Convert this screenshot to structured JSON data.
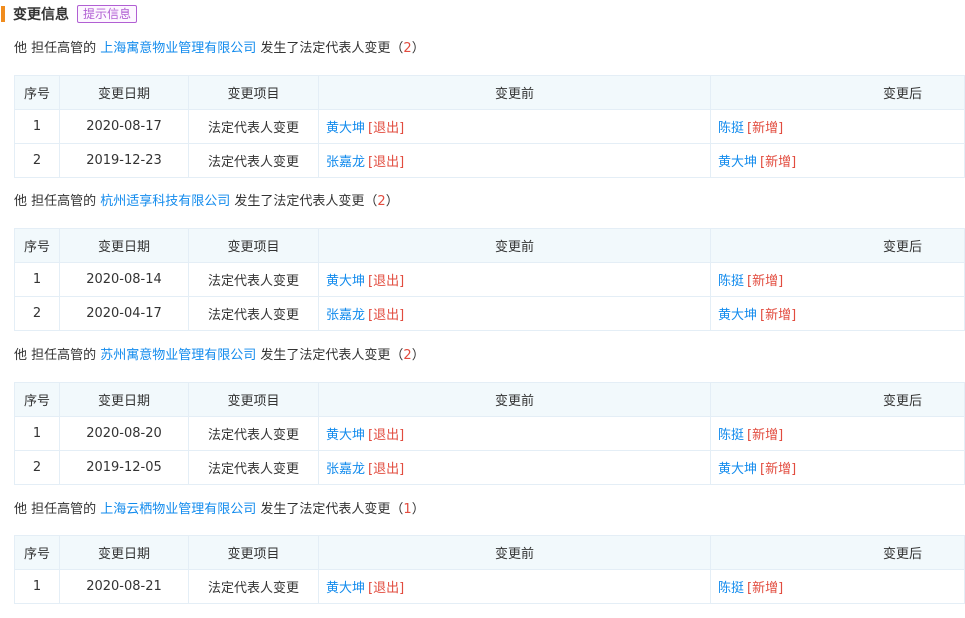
{
  "header": {
    "title": "变更信息",
    "tip_button": "提示信息"
  },
  "columns": [
    "序号",
    "变更日期",
    "变更项目",
    "变更前",
    "变更后"
  ],
  "sections": [
    {
      "prefix": "他 担任高管的 ",
      "company": "上海寓意物业管理有限公司",
      "suffix": " 发生了法定代表人变更（",
      "count": "2",
      "close": "）",
      "rows": [
        {
          "idx": "1",
          "date": "2020-08-17",
          "item": "法定代表人变更",
          "before_name": "黄大坤",
          "before_tag": "[退出]",
          "after_name": "陈挺",
          "after_tag": "[新增]"
        },
        {
          "idx": "2",
          "date": "2019-12-23",
          "item": "法定代表人变更",
          "before_name": "张嘉龙",
          "before_tag": "[退出]",
          "after_name": "黄大坤",
          "after_tag": "[新增]"
        }
      ]
    },
    {
      "prefix": "他 担任高管的 ",
      "company": "杭州适享科技有限公司",
      "suffix": " 发生了法定代表人变更（",
      "count": "2",
      "close": "）",
      "rows": [
        {
          "idx": "1",
          "date": "2020-08-14",
          "item": "法定代表人变更",
          "before_name": "黄大坤",
          "before_tag": "[退出]",
          "after_name": "陈挺",
          "after_tag": "[新增]"
        },
        {
          "idx": "2",
          "date": "2020-04-17",
          "item": "法定代表人变更",
          "before_name": "张嘉龙",
          "before_tag": "[退出]",
          "after_name": "黄大坤",
          "after_tag": "[新增]"
        }
      ]
    },
    {
      "prefix": "他 担任高管的 ",
      "company": "苏州寓意物业管理有限公司",
      "suffix": " 发生了法定代表人变更（",
      "count": "2",
      "close": "）",
      "rows": [
        {
          "idx": "1",
          "date": "2020-08-20",
          "item": "法定代表人变更",
          "before_name": "黄大坤",
          "before_tag": "[退出]",
          "after_name": "陈挺",
          "after_tag": "[新增]"
        },
        {
          "idx": "2",
          "date": "2019-12-05",
          "item": "法定代表人变更",
          "before_name": "张嘉龙",
          "before_tag": "[退出]",
          "after_name": "黄大坤",
          "after_tag": "[新增]"
        }
      ]
    },
    {
      "prefix": "他 担任高管的 ",
      "company": "上海云栖物业管理有限公司",
      "suffix": " 发生了法定代表人变更（",
      "count": "1",
      "close": "）",
      "rows": [
        {
          "idx": "1",
          "date": "2020-08-21",
          "item": "法定代表人变更",
          "before_name": "黄大坤",
          "before_tag": "[退出]",
          "after_name": "陈挺",
          "after_tag": "[新增]"
        }
      ]
    }
  ]
}
